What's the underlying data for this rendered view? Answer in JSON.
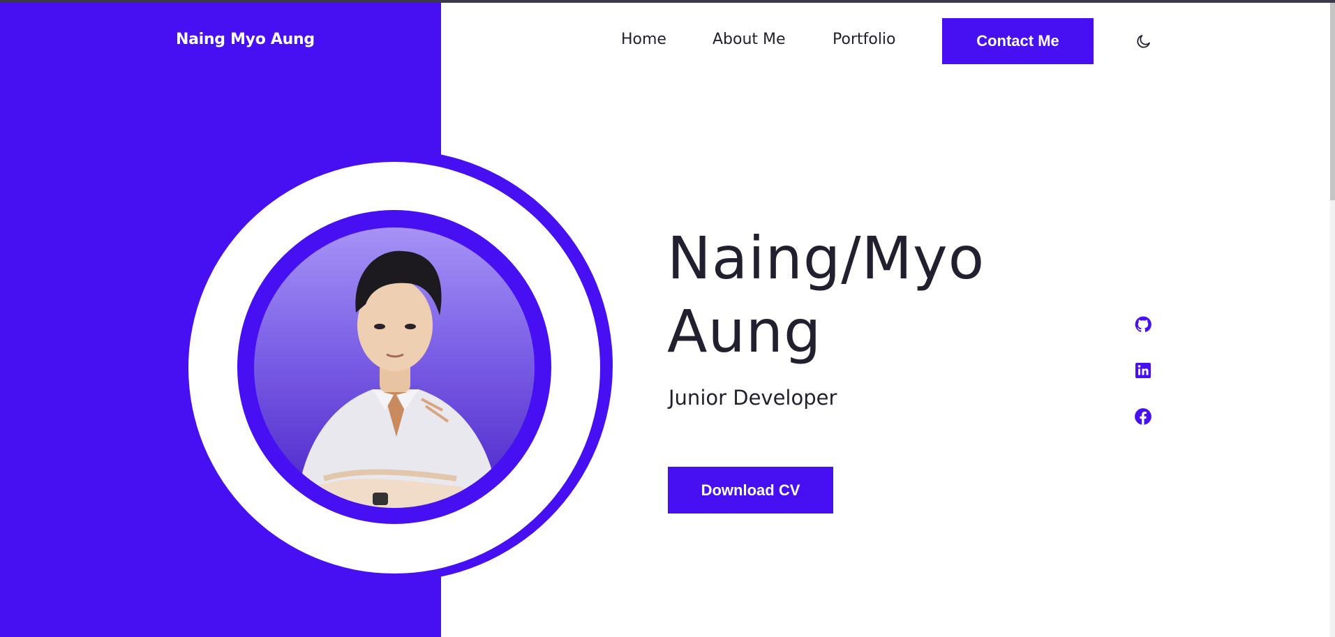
{
  "brand": {
    "name": "Naing Myo Aung"
  },
  "nav": {
    "items": [
      {
        "label": "Home"
      },
      {
        "label": "About Me"
      },
      {
        "label": "Portfolio"
      }
    ],
    "contact_label": "Contact Me",
    "theme_icon": "moon-icon"
  },
  "hero": {
    "name_line1": "Naing/Myo",
    "name_line2": "Aung",
    "role": "Junior Developer",
    "download_label": "Download CV",
    "photo_icon": "profile-photo"
  },
  "social": [
    {
      "icon": "github-icon"
    },
    {
      "icon": "linkedin-icon"
    },
    {
      "icon": "facebook-icon"
    }
  ],
  "colors": {
    "accent": "#4710f2",
    "text": "#22202e",
    "background": "#ffffff"
  }
}
